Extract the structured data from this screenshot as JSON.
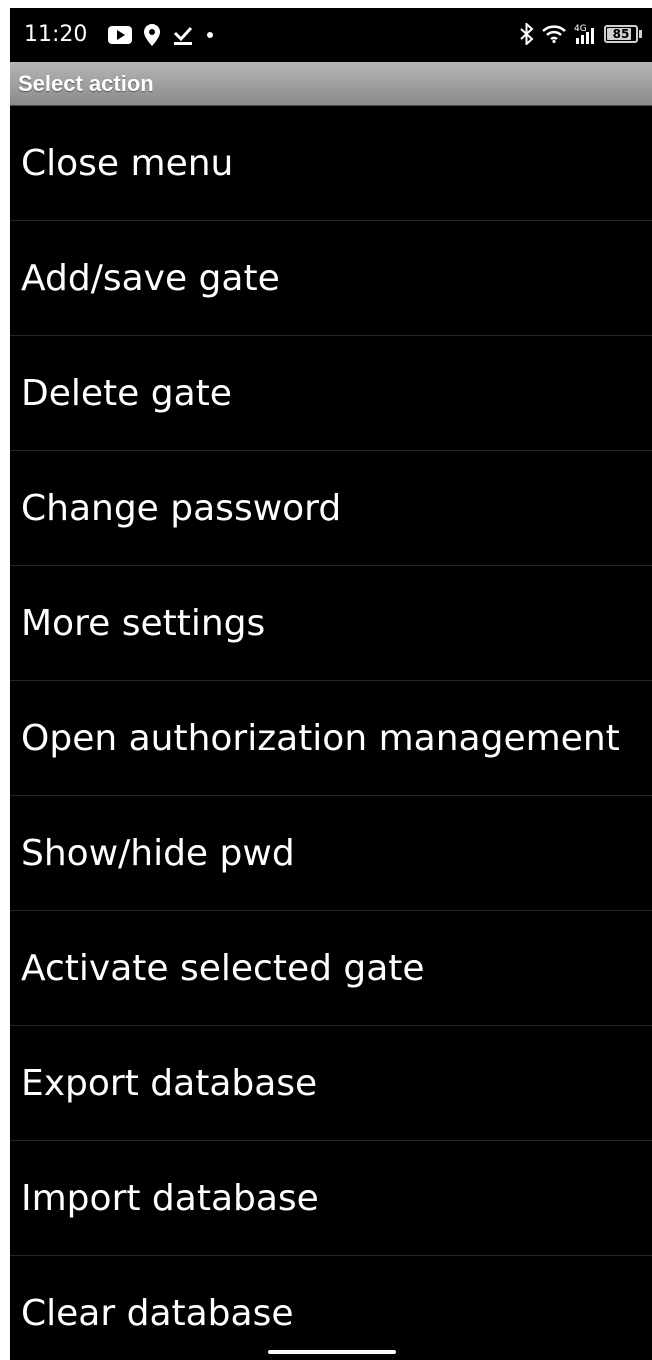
{
  "status_bar": {
    "time": "11:20",
    "network_label": "4G",
    "battery_percent": "85",
    "battery_level": 0.85,
    "left_icons": [
      "youtube-icon",
      "location-pin-icon",
      "download-done-icon",
      "notification-dot-icon"
    ],
    "right_icons": [
      "bluetooth-icon",
      "wifi-icon",
      "signal-4g-icon",
      "battery-icon"
    ]
  },
  "dialog": {
    "title": "Select action"
  },
  "menu": {
    "items": [
      {
        "label": "Close menu"
      },
      {
        "label": "Add/save gate"
      },
      {
        "label": "Delete gate"
      },
      {
        "label": "Change password"
      },
      {
        "label": "More settings"
      },
      {
        "label": "Open authorization management"
      },
      {
        "label": "Show/hide pwd"
      },
      {
        "label": "Activate selected gate"
      },
      {
        "label": "Export database"
      },
      {
        "label": "Import database"
      },
      {
        "label": "Clear database"
      }
    ]
  },
  "colors": {
    "background": "#000000",
    "title_bar": "#a0a0a0",
    "text": "#ffffff",
    "divider": "#262626"
  }
}
